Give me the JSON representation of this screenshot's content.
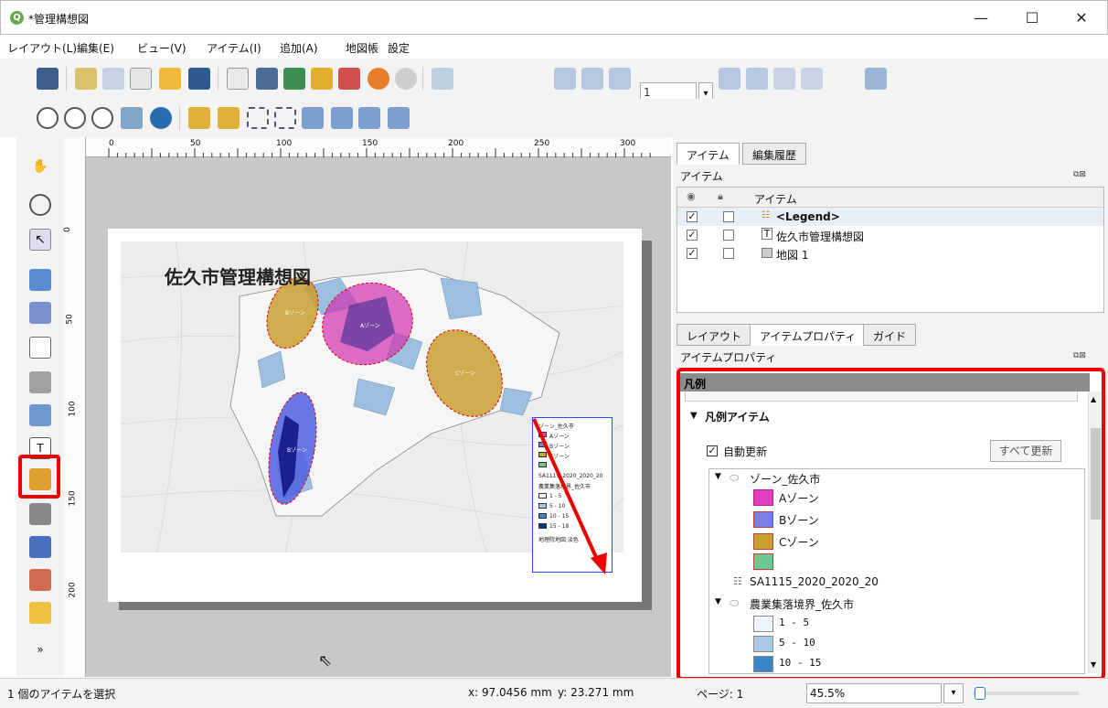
{
  "window": {
    "title": "*管理構想図",
    "app_icon": "qgis-icon",
    "minimize": "—",
    "maximize": "☐",
    "close": "✕"
  },
  "menu": [
    "レイアウト(L)",
    "編集(E)",
    "ビュー(V)",
    "アイテム(I)",
    "追加(A)",
    "地図帳",
    "設定"
  ],
  "toolbar": {
    "page_value": "1",
    "page_dropdown": "▾"
  },
  "layout": {
    "map_title": "佐久市管理構想図",
    "ruler_h": [
      "0",
      "50",
      "100",
      "150",
      "200",
      "250",
      "300"
    ],
    "ruler_v": [
      "0",
      "50",
      "100",
      "150",
      "200"
    ],
    "zone_labels": [
      "Bゾーン",
      "Aゾーン",
      "Cゾーン",
      "Bゾーン"
    ],
    "legend": {
      "items": [
        "ゾーン_佐久市",
        "Aゾーン",
        "Bゾーン",
        "Cゾーン",
        "",
        "SA1115_2020_2020_20",
        "農業集落境界_佐久市",
        "1 - 5",
        "5 - 10",
        "10 - 15",
        "15 - 18",
        "地理院地図 淡色"
      ]
    }
  },
  "right_panel": {
    "tabs_top": [
      "アイテム",
      "編集履歴"
    ],
    "items_title": "アイテム",
    "items_header": "アイテム",
    "items": [
      {
        "label": "<Legend>",
        "visible": "✓",
        "icon": "legend-icon"
      },
      {
        "label": "佐久市管理構想図",
        "visible": "✓",
        "icon": "text-icon"
      },
      {
        "label": "地図 1",
        "visible": "✓",
        "icon": "map-icon"
      }
    ],
    "tabs_bottom": [
      "レイアウト",
      "アイテムプロパティ",
      "ガイド"
    ],
    "props_title": "アイテムプロパティ",
    "legend_header": "凡例",
    "section_title": "凡例アイテム",
    "auto_update": {
      "checked": "✓",
      "label": "自動更新"
    },
    "update_all_button": "すべて更新",
    "tree": [
      {
        "label": "ゾーン_佐久市",
        "kind": "group"
      },
      {
        "label": "Aゾーン",
        "color": "#e040c0"
      },
      {
        "label": "Bゾーン",
        "color": "#7a80e0"
      },
      {
        "label": "Cゾーン",
        "color": "#c8a030"
      },
      {
        "label": "",
        "color": "#70c890"
      },
      {
        "label": "SA1115_2020_2020_20",
        "kind": "table"
      },
      {
        "label": "農業集落境界_佐久市",
        "kind": "group"
      },
      {
        "label": "1 - 5",
        "color": "#eef4fb"
      },
      {
        "label": "5 - 10",
        "color": "#a8c8e4"
      },
      {
        "label": "10 - 15",
        "color": "#3a86c6"
      }
    ]
  },
  "status": {
    "message": "1 個のアイテムを選択",
    "x": "x: 97.0456 mm",
    "y": "y: 23.271 mm",
    "page": "ページ: 1",
    "zoom": "45.5%"
  },
  "colors": {
    "highlight": "#e00000",
    "zone_a": "#e040c0",
    "zone_b": "#6070e0",
    "zone_c": "#c8a030"
  }
}
